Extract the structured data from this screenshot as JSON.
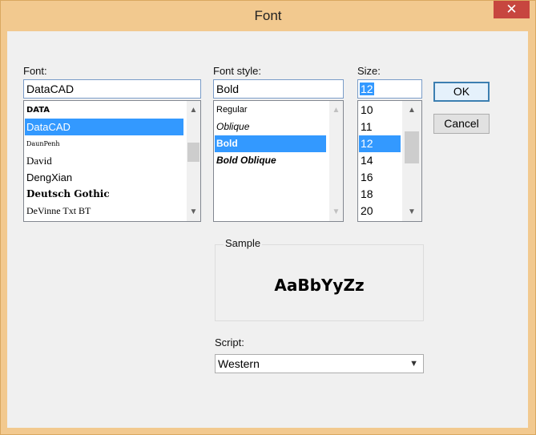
{
  "window": {
    "title": "Font",
    "close_glyph": "✕"
  },
  "font": {
    "label": "Font:",
    "value": "DataCAD",
    "items": [
      {
        "label": "DATA",
        "style": "font-weight:bold;font-size:10px;font-family:'DejaVu Sans',sans-serif;",
        "selected": false
      },
      {
        "label": "DataCAD",
        "style": "font-size:13px;",
        "selected": true
      },
      {
        "label": "DaunPenh",
        "style": "font-size:8px;font-family:'DejaVu Serif',serif;",
        "selected": false
      },
      {
        "label": "David",
        "style": "font-size:13px;font-family:'Liberation Serif',serif;",
        "selected": false
      },
      {
        "label": "DengXian",
        "style": "font-size:13px;",
        "selected": false
      },
      {
        "label": "Deutsch Gothic",
        "style": "font-weight:bold;font-size:12px;font-family:'DejaVu Serif',serif;",
        "selected": false
      },
      {
        "label": "DeVinne Txt BT",
        "style": "font-size:12px;font-family:'Liberation Serif',serif;",
        "selected": false
      }
    ]
  },
  "style": {
    "label": "Font style:",
    "value": "Bold",
    "items": [
      {
        "label": "Regular",
        "style": "font-size:11px;",
        "selected": false
      },
      {
        "label": "Oblique",
        "style": "font-style:italic;font-size:12px;",
        "selected": false
      },
      {
        "label": "Bold",
        "style": "font-weight:bold;font-size:12px;",
        "selected": true
      },
      {
        "label": "Bold Oblique",
        "style": "font-weight:bold;font-style:italic;font-size:12px;",
        "selected": false
      }
    ]
  },
  "size": {
    "label": "Size:",
    "value": "12",
    "items": [
      {
        "label": "10",
        "selected": false
      },
      {
        "label": "11",
        "selected": false
      },
      {
        "label": "12",
        "selected": true
      },
      {
        "label": "14",
        "selected": false
      },
      {
        "label": "16",
        "selected": false
      },
      {
        "label": "18",
        "selected": false
      },
      {
        "label": "20",
        "selected": false
      }
    ]
  },
  "buttons": {
    "ok": "OK",
    "cancel": "Cancel"
  },
  "sample": {
    "label": "Sample",
    "text": "AaBbYyZz"
  },
  "script": {
    "label": "Script:",
    "value": "Western"
  },
  "icons": {
    "scroll_up": "chevron-up-icon",
    "scroll_down": "chevron-down-icon",
    "dropdown": "chevron-down-icon"
  },
  "colors": {
    "title_bar": "#f2c98f",
    "close_button": "#c7463f",
    "selection": "#3399ff",
    "text_box_border": "#7a9cc8"
  }
}
